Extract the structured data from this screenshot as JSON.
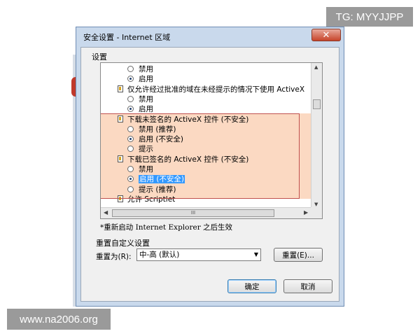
{
  "watermarks": {
    "tg": "TG: MYYJJPP",
    "site": "www.na2006.org"
  },
  "dialog": {
    "title": "安全设置 - Internet 区域",
    "close_symbol": "✕",
    "settings_label": "设置",
    "list_rows": [
      {
        "kind": "radio",
        "indent": 1,
        "text": "禁用",
        "checked": false
      },
      {
        "kind": "radio",
        "indent": 1,
        "text": "启用",
        "checked": true
      },
      {
        "kind": "doc",
        "indent": 0,
        "text": "仅允许经过批准的域在未经提示的情况下使用 ActiveX"
      },
      {
        "kind": "radio",
        "indent": 1,
        "text": "禁用",
        "checked": false
      },
      {
        "kind": "radio",
        "indent": 1,
        "text": "启用",
        "checked": true
      },
      {
        "kind": "doc",
        "indent": 0,
        "text": "下载未签名的 ActiveX 控件 (不安全)"
      },
      {
        "kind": "radio",
        "indent": 1,
        "text": "禁用 (推荐)",
        "checked": false
      },
      {
        "kind": "radio",
        "indent": 1,
        "text": "启用 (不安全)",
        "checked": true
      },
      {
        "kind": "radio",
        "indent": 1,
        "text": "提示",
        "checked": false
      },
      {
        "kind": "doc",
        "indent": 0,
        "text": "下载已签名的 ActiveX 控件 (不安全)"
      },
      {
        "kind": "radio",
        "indent": 1,
        "text": "禁用",
        "checked": false
      },
      {
        "kind": "radio",
        "indent": 1,
        "text": "启用 (不安全)",
        "checked": true,
        "selected": true
      },
      {
        "kind": "radio",
        "indent": 1,
        "text": "提示 (推荐)",
        "checked": false
      },
      {
        "kind": "doc",
        "indent": 0,
        "text": "允许 Scriptlet"
      }
    ],
    "restart_note": "*重新启动 Internet Explorer 之后生效",
    "custom_group_title": "重置自定义设置",
    "reset_to_label": "重置为(R):",
    "reset_level_value": "中-高 (默认)",
    "reset_button": "重置(E)...",
    "ok_button": "确定",
    "cancel_button": "取消",
    "hscroll_grip": "III"
  }
}
